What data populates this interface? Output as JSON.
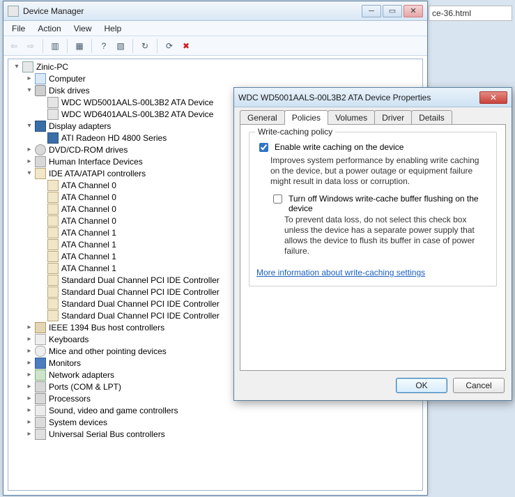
{
  "background": {
    "browser_fragment": "ce-36.html"
  },
  "devmgr": {
    "title": "Device Manager",
    "menus": [
      "File",
      "Action",
      "View",
      "Help"
    ],
    "toolbar_icons": [
      "back",
      "forward",
      "up-level",
      "properties",
      "help",
      "show-hidden",
      "scan-hardware",
      "update-driver",
      "uninstall"
    ],
    "root": "Zinic-PC",
    "categories": [
      {
        "label": "Computer",
        "icon": "ic-pc",
        "expanded": false
      },
      {
        "label": "Disk drives",
        "icon": "ic-disk",
        "expanded": true,
        "children": [
          {
            "label": "WDC WD5001AALS-00L3B2 ATA Device",
            "icon": "ic-drv"
          },
          {
            "label": "WDC WD6401AALS-00L3B2 ATA Device",
            "icon": "ic-drv"
          }
        ]
      },
      {
        "label": "Display adapters",
        "icon": "ic-disp",
        "expanded": true,
        "children": [
          {
            "label": "ATI Radeon HD 4800 Series",
            "icon": "ic-disp"
          }
        ]
      },
      {
        "label": "DVD/CD-ROM drives",
        "icon": "ic-dvd",
        "expanded": false
      },
      {
        "label": "Human Interface Devices",
        "icon": "ic-hid",
        "expanded": false
      },
      {
        "label": "IDE ATA/ATAPI controllers",
        "icon": "ic-ide",
        "expanded": true,
        "children": [
          {
            "label": "ATA Channel 0",
            "icon": "ic-ide"
          },
          {
            "label": "ATA Channel 0",
            "icon": "ic-ide"
          },
          {
            "label": "ATA Channel 0",
            "icon": "ic-ide"
          },
          {
            "label": "ATA Channel 0",
            "icon": "ic-ide"
          },
          {
            "label": "ATA Channel 1",
            "icon": "ic-ide"
          },
          {
            "label": "ATA Channel 1",
            "icon": "ic-ide"
          },
          {
            "label": "ATA Channel 1",
            "icon": "ic-ide"
          },
          {
            "label": "ATA Channel 1",
            "icon": "ic-ide"
          },
          {
            "label": "Standard Dual Channel PCI IDE Controller",
            "icon": "ic-ide"
          },
          {
            "label": "Standard Dual Channel PCI IDE Controller",
            "icon": "ic-ide"
          },
          {
            "label": "Standard Dual Channel PCI IDE Controller",
            "icon": "ic-ide"
          },
          {
            "label": "Standard Dual Channel PCI IDE Controller",
            "icon": "ic-ide"
          }
        ]
      },
      {
        "label": "IEEE 1394 Bus host controllers",
        "icon": "ic-1394",
        "expanded": false
      },
      {
        "label": "Keyboards",
        "icon": "ic-kbd",
        "expanded": false
      },
      {
        "label": "Mice and other pointing devices",
        "icon": "ic-mouse",
        "expanded": false
      },
      {
        "label": "Monitors",
        "icon": "ic-mon",
        "expanded": false
      },
      {
        "label": "Network adapters",
        "icon": "ic-net",
        "expanded": false
      },
      {
        "label": "Ports (COM & LPT)",
        "icon": "ic-port",
        "expanded": false
      },
      {
        "label": "Processors",
        "icon": "ic-proc",
        "expanded": false
      },
      {
        "label": "Sound, video and game controllers",
        "icon": "ic-snd",
        "expanded": false
      },
      {
        "label": "System devices",
        "icon": "ic-sys",
        "expanded": false
      },
      {
        "label": "Universal Serial Bus controllers",
        "icon": "ic-usb",
        "expanded": false
      }
    ]
  },
  "props": {
    "title": "WDC WD5001AALS-00L3B2 ATA Device Properties",
    "tabs": [
      "General",
      "Policies",
      "Volumes",
      "Driver",
      "Details"
    ],
    "active_tab": 1,
    "group_legend": "Write-caching policy",
    "chk1_label": "Enable write caching on the device",
    "chk1_checked": true,
    "chk1_desc": "Improves system performance by enabling write caching on the device, but a power outage or equipment failure might result in data loss or corruption.",
    "chk2_label": "Turn off Windows write-cache buffer flushing on the device",
    "chk2_checked": false,
    "chk2_desc": "To prevent data loss, do not select this check box unless the device has a separate power supply that allows the device to flush its buffer in case of power failure.",
    "link": "More information about write-caching settings",
    "ok": "OK",
    "cancel": "Cancel"
  }
}
